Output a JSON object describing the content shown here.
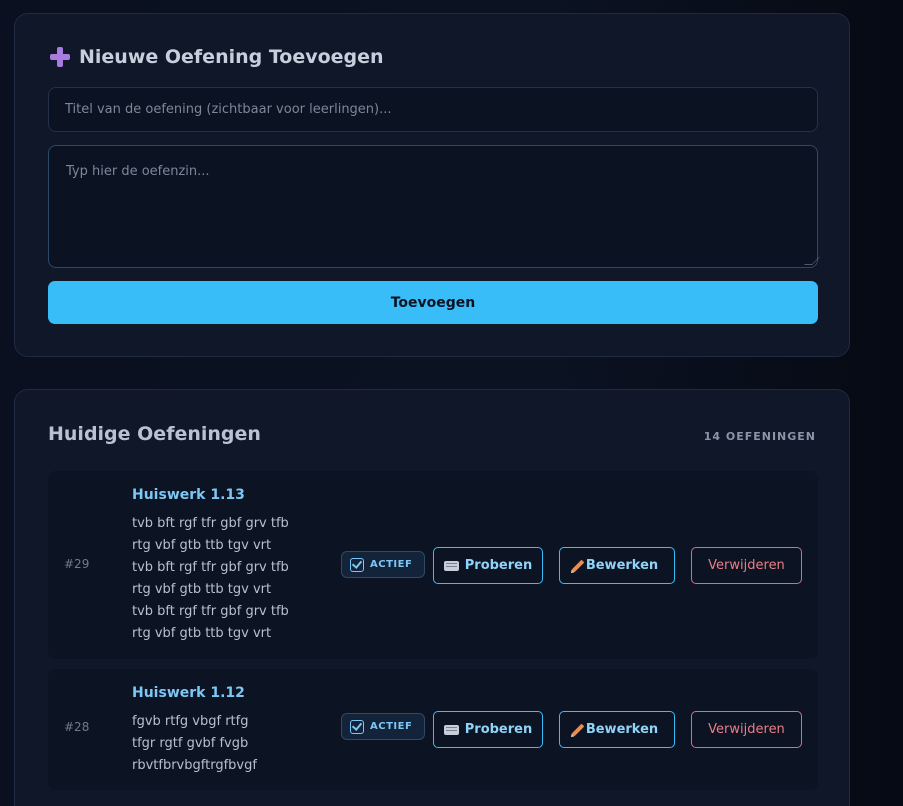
{
  "add_section": {
    "title": "Nieuwe Oefening Toevoegen",
    "title_placeholder": "Titel van de oefening (zichtbaar voor leerlingen)...",
    "sentence_placeholder": "Typ hier de oefenzin...",
    "add_button_label": "Toevoegen"
  },
  "list_section": {
    "title": "Huidige Oefeningen",
    "count_label": "14 OEFENINGEN",
    "exercises": [
      {
        "id": "#29",
        "name": "Huiswerk 1.13",
        "text": "tvb bft rgf tfr gbf grv tfb\nrtg vbf gtb ttb tgv vrt\ntvb bft rgf tfr gbf grv tfb\nrtg vbf gtb ttb tgv vrt\ntvb bft rgf tfr gbf grv tfb\nrtg vbf gtb ttb tgv vrt",
        "status": "ACTIEF",
        "try_label": "Proberen",
        "edit_label": "Bewerken",
        "delete_label": "Verwijderen"
      },
      {
        "id": "#28",
        "name": "Huiswerk 1.12",
        "text": "fgvb rtfg vbgf rtfg\ntfgr rgtf gvbf fvgb\nrbvtfbrvbgftrgfbvgf",
        "status": "ACTIEF",
        "try_label": "Proberen",
        "edit_label": "Bewerken",
        "delete_label": "Verwijderen"
      }
    ]
  },
  "colors": {
    "accent": "#38bdf8",
    "danger": "#e06c75",
    "plus_icon": "#a77be0",
    "card_bg": "#0f1729"
  },
  "icons": {
    "add_title": "plus-icon",
    "status": "check-icon",
    "try": "keyboard-icon",
    "edit": "pencil-icon"
  }
}
